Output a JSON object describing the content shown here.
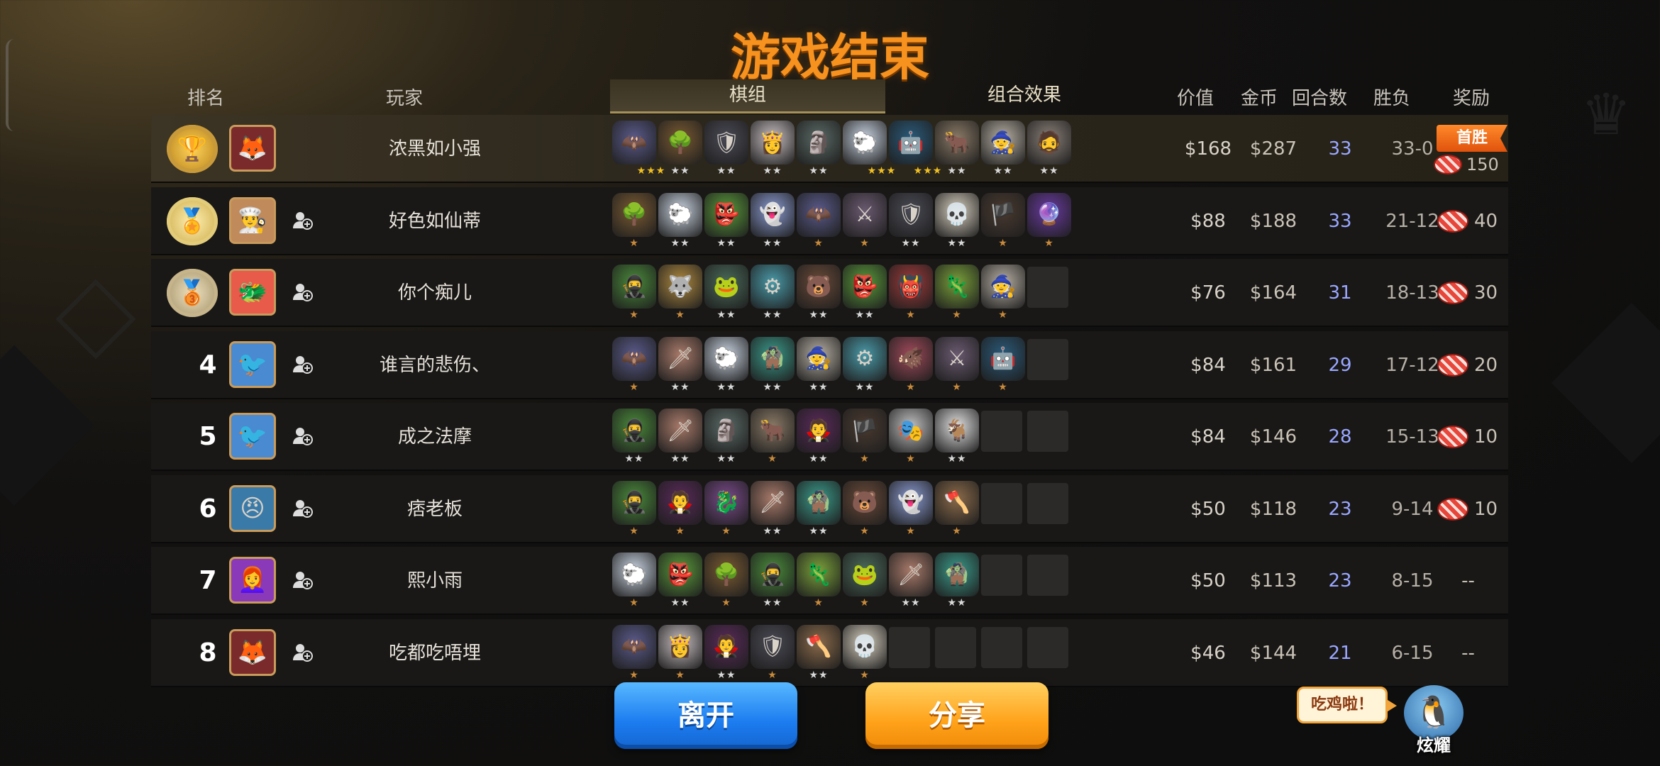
{
  "title": "游戏结束",
  "headers": {
    "rank": "排名",
    "player": "玩家",
    "lineup": "棋组",
    "synergy": "组合效果",
    "value": "价值",
    "gold": "金币",
    "rounds": "回合数",
    "record": "胜负",
    "reward": "奖励"
  },
  "rows": [
    {
      "rank": "1",
      "name": "浓黑如小强",
      "value": "$168",
      "gold": "$287",
      "rounds": "33",
      "record": "33-0",
      "reward": "150",
      "win_label": "首胜",
      "avatar_icon": "fox-mask-icon",
      "pieces": [
        {
          "icon": "bat",
          "stars": "★★★",
          "tier": "gold"
        },
        {
          "icon": "treant",
          "stars": "★★",
          "tier": "silver"
        },
        {
          "icon": "knight",
          "stars": "★★",
          "tier": "silver"
        },
        {
          "icon": "priestess",
          "stars": "★★",
          "tier": "silver"
        },
        {
          "icon": "golem",
          "stars": "★★",
          "tier": "silver"
        },
        {
          "icon": "yeti",
          "stars": "★★★",
          "tier": "gold"
        },
        {
          "icon": "robot",
          "stars": "★★★",
          "tier": "gold"
        },
        {
          "icon": "minotaur",
          "stars": "★★",
          "tier": "silver"
        },
        {
          "icon": "elder",
          "stars": "★★",
          "tier": "silver"
        },
        {
          "icon": "monk",
          "stars": "★★",
          "tier": "silver"
        }
      ]
    },
    {
      "rank": "2",
      "name": "好色如仙蒂",
      "value": "$88",
      "gold": "$188",
      "rounds": "33",
      "record": "21-12",
      "reward": "40",
      "avatar_icon": "chef-icon",
      "pieces": [
        {
          "icon": "treant",
          "stars": "★",
          "tier": "bronze"
        },
        {
          "icon": "yeti",
          "stars": "★★",
          "tier": "silver"
        },
        {
          "icon": "goblin",
          "stars": "★★",
          "tier": "silver"
        },
        {
          "icon": "ghost",
          "stars": "★★",
          "tier": "silver"
        },
        {
          "icon": "bat",
          "stars": "★",
          "tier": "bronze"
        },
        {
          "icon": "warrior",
          "stars": "★",
          "tier": "bronze"
        },
        {
          "icon": "knight",
          "stars": "★★",
          "tier": "silver"
        },
        {
          "icon": "skull",
          "stars": "★★",
          "tier": "silver"
        },
        {
          "icon": "pirate",
          "stars": "★",
          "tier": "bronze"
        },
        {
          "icon": "wizard",
          "stars": "★",
          "tier": "bronze"
        }
      ]
    },
    {
      "rank": "3",
      "name": "你个痴儿",
      "value": "$76",
      "gold": "$164",
      "rounds": "31",
      "record": "18-13",
      "reward": "30",
      "avatar_icon": "dragon-icon",
      "pieces": [
        {
          "icon": "bandit",
          "stars": "★",
          "tier": "bronze"
        },
        {
          "icon": "anubis",
          "stars": "★",
          "tier": "bronze"
        },
        {
          "icon": "frog",
          "stars": "★★",
          "tier": "silver"
        },
        {
          "icon": "mech",
          "stars": "★★",
          "tier": "silver"
        },
        {
          "icon": "bear",
          "stars": "★★",
          "tier": "silver"
        },
        {
          "icon": "goblin",
          "stars": "★★",
          "tier": "silver"
        },
        {
          "icon": "demon",
          "stars": "★",
          "tier": "bronze"
        },
        {
          "icon": "shaman",
          "stars": "★",
          "tier": "bronze"
        },
        {
          "icon": "elder",
          "stars": "★",
          "tier": "bronze"
        },
        {
          "icon": "",
          "stars": "",
          "tier": "empty"
        }
      ]
    },
    {
      "rank": "4",
      "name": "谁言的悲伤、",
      "value": "$84",
      "gold": "$161",
      "rounds": "29",
      "record": "17-12",
      "reward": "20",
      "avatar_icon": "bird-icon",
      "pieces": [
        {
          "icon": "bat",
          "stars": "★",
          "tier": "bronze"
        },
        {
          "icon": "assassin",
          "stars": "★★",
          "tier": "silver"
        },
        {
          "icon": "yeti",
          "stars": "★★",
          "tier": "silver"
        },
        {
          "icon": "troll",
          "stars": "★★",
          "tier": "silver"
        },
        {
          "icon": "elder",
          "stars": "★★",
          "tier": "silver"
        },
        {
          "icon": "mech",
          "stars": "★★",
          "tier": "silver"
        },
        {
          "icon": "orc",
          "stars": "★",
          "tier": "bronze"
        },
        {
          "icon": "warrior",
          "stars": "★",
          "tier": "bronze"
        },
        {
          "icon": "robot",
          "stars": "★",
          "tier": "bronze"
        },
        {
          "icon": "",
          "stars": "",
          "tier": "empty"
        }
      ]
    },
    {
      "rank": "5",
      "name": "成之法摩",
      "value": "$84",
      "gold": "$146",
      "rounds": "28",
      "record": "15-13",
      "reward": "10",
      "avatar_icon": "bird-icon",
      "pieces": [
        {
          "icon": "bandit",
          "stars": "★★",
          "tier": "silver"
        },
        {
          "icon": "assassin",
          "stars": "★★",
          "tier": "silver"
        },
        {
          "icon": "golem",
          "stars": "★★",
          "tier": "silver"
        },
        {
          "icon": "minotaur",
          "stars": "★",
          "tier": "bronze"
        },
        {
          "icon": "witch",
          "stars": "★★",
          "tier": "silver"
        },
        {
          "icon": "pirate",
          "stars": "★",
          "tier": "bronze"
        },
        {
          "icon": "ninja",
          "stars": "★",
          "tier": "bronze"
        },
        {
          "icon": "goat",
          "stars": "★★",
          "tier": "silver"
        },
        {
          "icon": "",
          "stars": "",
          "tier": "empty"
        },
        {
          "icon": "",
          "stars": "",
          "tier": "empty"
        }
      ]
    },
    {
      "rank": "6",
      "name": "痞老板",
      "value": "$50",
      "gold": "$118",
      "rounds": "23",
      "record": "9-14",
      "reward": "10",
      "avatar_icon": "bandit-face-icon",
      "pieces": [
        {
          "icon": "bandit",
          "stars": "★",
          "tier": "bronze"
        },
        {
          "icon": "witch",
          "stars": "★",
          "tier": "bronze"
        },
        {
          "icon": "dragonling",
          "stars": "★",
          "tier": "bronze"
        },
        {
          "icon": "assassin",
          "stars": "★★",
          "tier": "silver"
        },
        {
          "icon": "troll",
          "stars": "★★",
          "tier": "silver"
        },
        {
          "icon": "bear",
          "stars": "★",
          "tier": "bronze"
        },
        {
          "icon": "ghost",
          "stars": "★",
          "tier": "bronze"
        },
        {
          "icon": "barbarian",
          "stars": "★",
          "tier": "bronze"
        },
        {
          "icon": "",
          "stars": "",
          "tier": "empty"
        },
        {
          "icon": "",
          "stars": "",
          "tier": "empty"
        }
      ]
    },
    {
      "rank": "7",
      "name": "熙小雨",
      "value": "$50",
      "gold": "$113",
      "rounds": "23",
      "record": "8-15",
      "reward": "--",
      "avatar_icon": "redhead-icon",
      "pieces": [
        {
          "icon": "yeti",
          "stars": "★",
          "tier": "bronze"
        },
        {
          "icon": "goblin",
          "stars": "★★",
          "tier": "silver"
        },
        {
          "icon": "treant",
          "stars": "★",
          "tier": "bronze"
        },
        {
          "icon": "bandit",
          "stars": "★★",
          "tier": "silver"
        },
        {
          "icon": "shaman",
          "stars": "★",
          "tier": "bronze"
        },
        {
          "icon": "frog",
          "stars": "★",
          "tier": "bronze"
        },
        {
          "icon": "assassin",
          "stars": "★★",
          "tier": "silver"
        },
        {
          "icon": "troll",
          "stars": "★★",
          "tier": "silver"
        },
        {
          "icon": "",
          "stars": "",
          "tier": "empty"
        },
        {
          "icon": "",
          "stars": "",
          "tier": "empty"
        }
      ]
    },
    {
      "rank": "8",
      "name": "吃都吃唔埋",
      "value": "$46",
      "gold": "$144",
      "rounds": "21",
      "record": "6-15",
      "reward": "--",
      "avatar_icon": "fox-mask-icon",
      "pieces": [
        {
          "icon": "bat",
          "stars": "★",
          "tier": "bronze"
        },
        {
          "icon": "priestess",
          "stars": "★",
          "tier": "bronze"
        },
        {
          "icon": "witch",
          "stars": "★★",
          "tier": "silver"
        },
        {
          "icon": "knight",
          "stars": "★",
          "tier": "bronze"
        },
        {
          "icon": "barbarian",
          "stars": "★★",
          "tier": "silver"
        },
        {
          "icon": "skull",
          "stars": "★",
          "tier": "bronze"
        },
        {
          "icon": "",
          "stars": "",
          "tier": "empty"
        },
        {
          "icon": "",
          "stars": "",
          "tier": "empty"
        },
        {
          "icon": "",
          "stars": "",
          "tier": "empty"
        },
        {
          "icon": "",
          "stars": "",
          "tier": "empty"
        }
      ]
    }
  ],
  "buttons": {
    "leave": "离开",
    "share": "分享"
  },
  "speech": "吃鸡啦！",
  "show_off": "炫耀",
  "colors": {
    "title": "#f7921e",
    "rounds": "#9aa7ff",
    "leave": "#1c7cf0",
    "share": "#ffa21a"
  }
}
